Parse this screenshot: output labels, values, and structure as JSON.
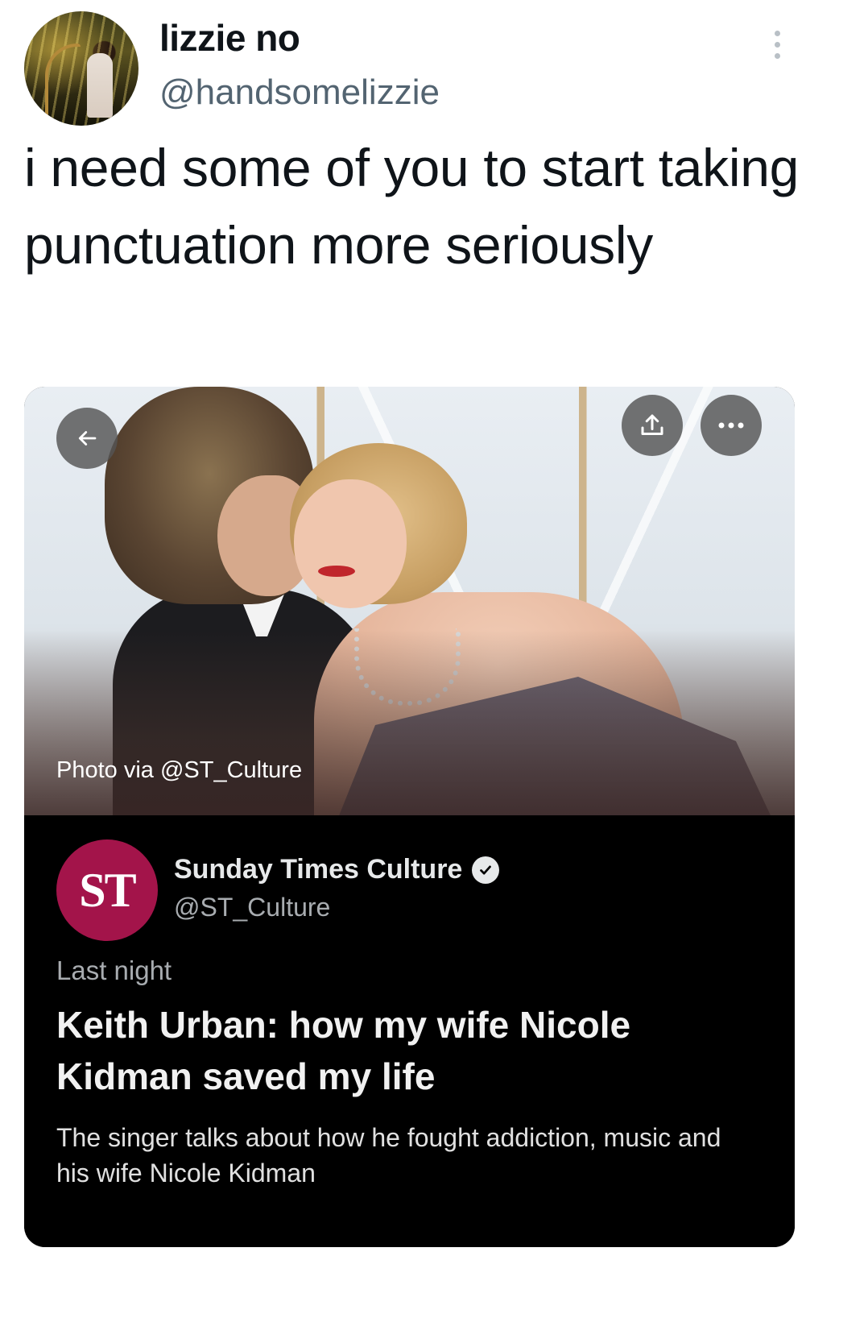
{
  "author": {
    "display_name": "lizzie no",
    "handle": "@handsomelizzie",
    "avatar_icon": "user-avatar"
  },
  "tweet": {
    "text": "i need some of you to start taking punctuation more seriously"
  },
  "card": {
    "photo_credit": "Photo via @ST_Culture",
    "publisher": {
      "logo_text": "ST",
      "logo_color": "#a3144a",
      "name": "Sunday Times Culture",
      "handle": "@ST_Culture",
      "verified": true
    },
    "time": "Last night",
    "headline": "Keith Urban: how my wife Nicole Kidman saved my life",
    "summary": "The singer talks about how he fought addiction, music and his wife Nicole Kidman"
  },
  "icons": {
    "back": "arrow-left-icon",
    "share": "share-icon",
    "more": "more-horizontal-icon",
    "overflow": "more-vertical-icon",
    "verified": "verified-badge-icon"
  }
}
